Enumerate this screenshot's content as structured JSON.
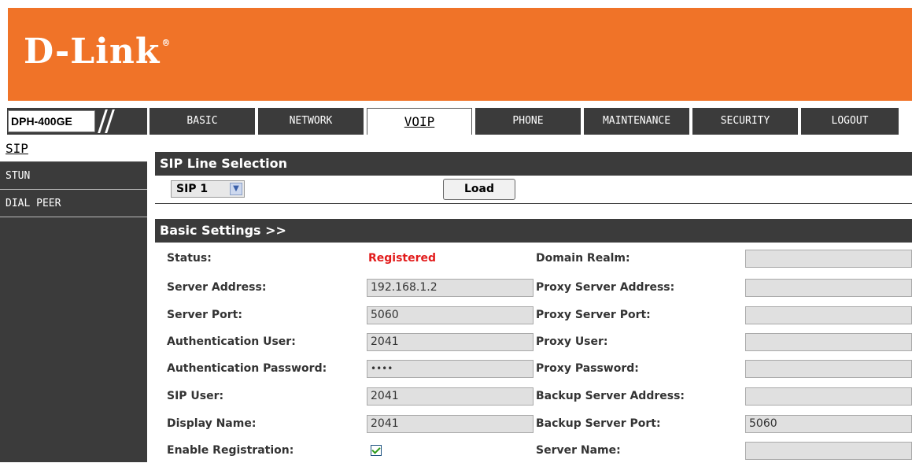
{
  "brand": {
    "logo_text": "D-Link",
    "registered_mark": "®"
  },
  "model": "DPH-400GE",
  "nav_tabs": [
    "BASIC",
    "NETWORK",
    "VOIP",
    "PHONE",
    "MAINTENANCE",
    "SECURITY",
    "LOGOUT"
  ],
  "nav_active": "VOIP",
  "sidebar": {
    "items": [
      "SIP",
      "STUN",
      "DIAL PEER"
    ],
    "active": "SIP"
  },
  "line_selection": {
    "header": "SIP Line Selection",
    "selected": "SIP 1",
    "load_label": "Load"
  },
  "basic_settings": {
    "header": "Basic Settings >>",
    "rows": [
      {
        "label": "Status:",
        "value": "Registered",
        "right_label": "Domain Realm:",
        "right_value": ""
      },
      {
        "label": "Server Address:",
        "value": "192.168.1.2",
        "right_label": "Proxy Server Address:",
        "right_value": ""
      },
      {
        "label": "Server Port:",
        "value": "5060",
        "right_label": "Proxy Server Port:",
        "right_value": ""
      },
      {
        "label": "Authentication User:",
        "value": "2041",
        "right_label": "Proxy User:",
        "right_value": ""
      },
      {
        "label": "Authentication Password:",
        "value": "••••",
        "right_label": "Proxy Password:",
        "right_value": ""
      },
      {
        "label": "SIP User:",
        "value": "2041",
        "right_label": "Backup Server Address:",
        "right_value": ""
      },
      {
        "label": "Display Name:",
        "value": "2041",
        "right_label": "Backup Server Port:",
        "right_value": "5060"
      },
      {
        "label": "Enable Registration:",
        "value": "",
        "checked": true,
        "right_label": "Server Name:",
        "right_value": ""
      }
    ]
  },
  "colors": {
    "banner": "#f07328",
    "dark": "#3b3b3b",
    "status_registered": "#e21b1b"
  }
}
